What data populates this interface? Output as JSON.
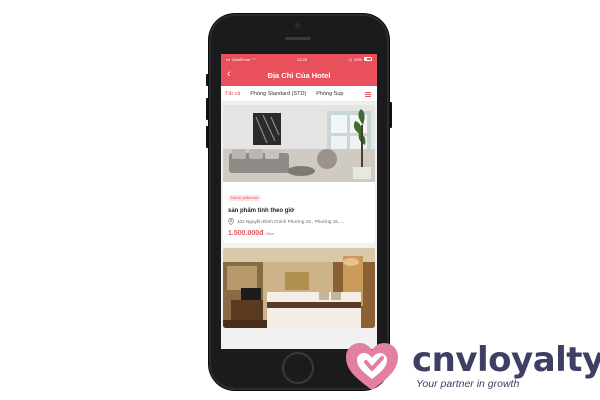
{
  "status_bar": {
    "carrier": "MobiFone",
    "time": "13:25",
    "battery": "29%"
  },
  "app_bar": {
    "back_icon": "chevron-left-icon",
    "title": "Địa Chỉ Của Hotel"
  },
  "tabs": [
    {
      "label": "Tất cả",
      "active": true
    },
    {
      "label": "Phòng Standard (STD)",
      "active": false
    },
    {
      "label": "Phòng Sup",
      "active": false
    }
  ],
  "listings": [
    {
      "badge": "Đại sứ phẩm sóc",
      "name": "sản phẩm tính theo giờ",
      "address": "102 Nguyễn Đình Chính Phường 15 , Phường 15, ...",
      "price": "1.500.000đ",
      "unit": "/đêm"
    },
    {}
  ],
  "logo": {
    "brand": "cnvloyalty",
    "tagline": "Your partner in growth"
  },
  "colors": {
    "accent": "#e8505b",
    "brand_navy": "#3e3f63",
    "logo_pink": "#e37fa2"
  }
}
